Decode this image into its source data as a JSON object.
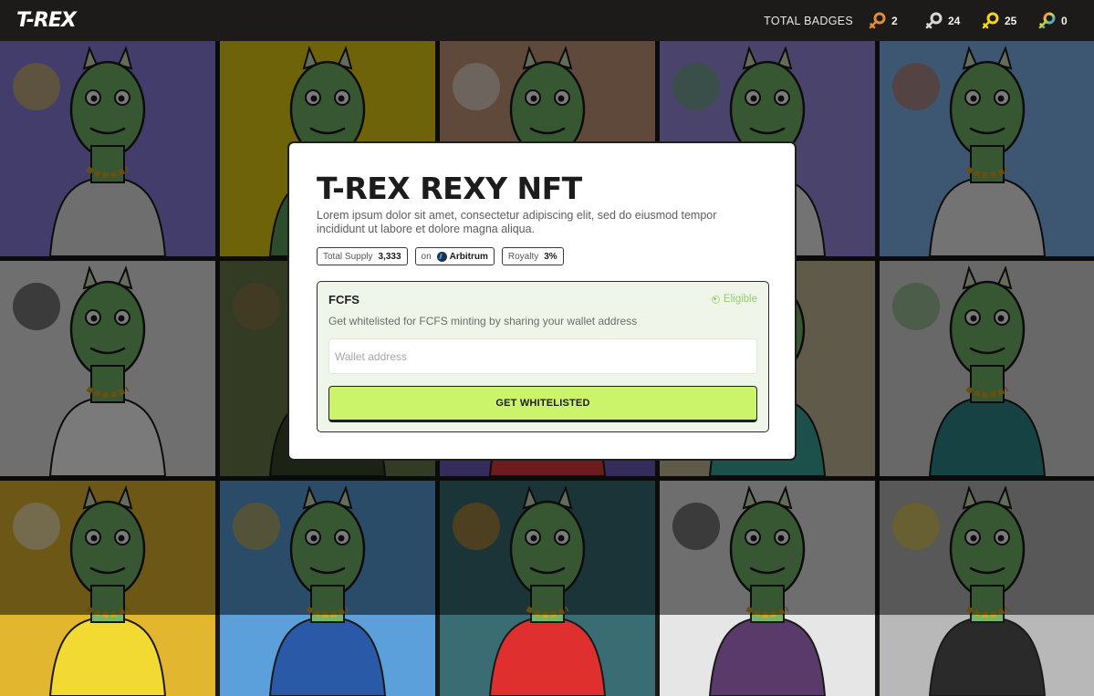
{
  "header": {
    "logo": "T-REX",
    "badges_label": "TOTAL BADGES",
    "badges": [
      {
        "icon": "bronze-key-icon",
        "color": "#e58a3a",
        "count": "2"
      },
      {
        "icon": "silver-key-icon",
        "color": "#d8d8d8",
        "count": "24"
      },
      {
        "icon": "gold-key-icon",
        "color": "#f2d51f",
        "count": "25"
      },
      {
        "icon": "rainbow-key-icon",
        "color": "#9b7ee0",
        "count": "0"
      }
    ]
  },
  "modal": {
    "title": "T-REX REXY NFT",
    "description": "Lorem ipsum dolor sit amet, consectetur adipiscing elit, sed do eiusmod tempor incididunt ut labore et dolore magna aliqua.",
    "chips": {
      "supply_label": "Total Supply",
      "supply_value": "3,333",
      "network_label": "on",
      "network_value": "Arbitrum",
      "royalty_label": "Royalty",
      "royalty_value": "3%"
    },
    "phase": {
      "title": "FCFS",
      "status": "Eligible",
      "subtitle": "Get whitelisted for FCFS minting by sharing your wallet address",
      "wallet_placeholder": "Wallet address",
      "wallet_value": "",
      "button_label": "GET WHITELISTED"
    }
  },
  "tiles": [
    {
      "bg": "#8a7fe0",
      "accent": "#f3d43b",
      "shirt": "#e6e6e6"
    },
    {
      "bg": "#e7cf12",
      "accent": "#e7cf12",
      "shirt": "#5fa05a"
    },
    {
      "bg": "#c49a7c",
      "accent": "#ffffff",
      "shirt": "#6fae6a"
    },
    {
      "bg": "#9b8ee2",
      "accent": "#5cb860",
      "shirt": "#f0f0f0"
    },
    {
      "bg": "#7fb6f0",
      "accent": "#d86b3a",
      "shirt": "#f0f0f0"
    },
    {
      "bg": "#e8e8e8",
      "accent": "#222222",
      "shirt": "#ffffff"
    },
    {
      "bg": "#6b7d4a",
      "accent": "#a27a4a",
      "shirt": "#3d4a2a"
    },
    {
      "bg": "#6d5fc0",
      "accent": "#e99bd9",
      "shirt": "#e23b3b"
    },
    {
      "bg": "#c9bd9c",
      "accent": "#6fae6a",
      "shirt": "#3aa99b"
    },
    {
      "bg": "#d9d9d9",
      "accent": "#6fae6a",
      "shirt": "#2f8a8e"
    },
    {
      "bg": "#e3b62f",
      "accent": "#ffffff",
      "shirt": "#f2da32"
    },
    {
      "bg": "#5b9fdb",
      "accent": "#f2b924",
      "shirt": "#2a59a8"
    },
    {
      "bg": "#3a6d73",
      "accent": "#f29b1d",
      "shirt": "#e02f2f"
    },
    {
      "bg": "#e6e6e6",
      "accent": "#222222",
      "shirt": "#5a3a6a"
    },
    {
      "bg": "#b8b8b8",
      "accent": "#f4d42a",
      "shirt": "#2a2a2a"
    }
  ]
}
